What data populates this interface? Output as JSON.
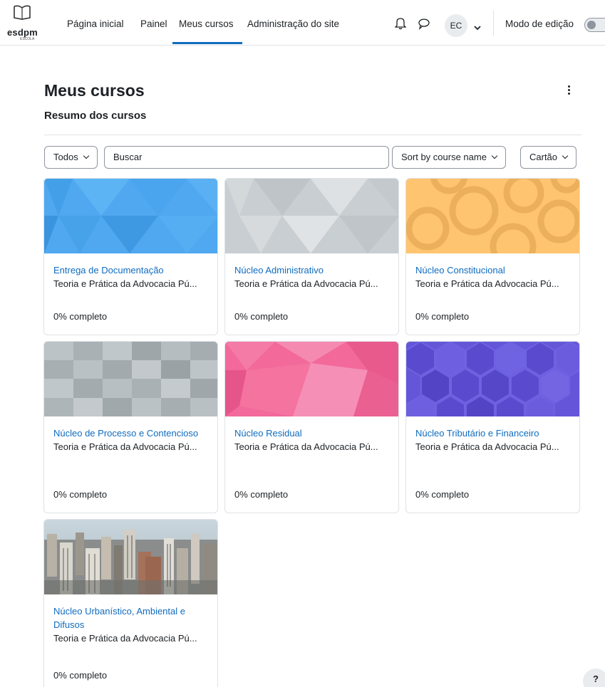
{
  "brand": {
    "name": "esdpm",
    "tagline": "ESCOLA"
  },
  "nav": {
    "items": [
      {
        "label": "Página inicial"
      },
      {
        "label": "Painel"
      },
      {
        "label": "Meus cursos"
      },
      {
        "label": "Administração do site"
      }
    ],
    "active": "Meus cursos",
    "user_initials": "EC",
    "edit_mode_label": "Modo de edição"
  },
  "header": {
    "title": "Meus cursos",
    "section": "Resumo dos cursos"
  },
  "filters": {
    "grouping": "Todos",
    "search_placeholder": "Buscar",
    "sort": "Sort by course name",
    "view": "Cartão"
  },
  "courses": [
    {
      "name": "Entrega de Documentação",
      "category": "Teoria e Prática da Advocacia Pú...",
      "progress": "0% completo",
      "pattern": "triangles",
      "color": "#4fa8f0"
    },
    {
      "name": "Núcleo Administrativo",
      "category": "Teoria e Prática da Advocacia Pú...",
      "progress": "0% completo",
      "pattern": "triangles",
      "color": "#c9ced2"
    },
    {
      "name": "Núcleo Constitucional",
      "category": "Teoria e Prática da Advocacia Pú...",
      "progress": "0% completo",
      "pattern": "circles",
      "color": "#ffc470"
    },
    {
      "name": "Núcleo de Processo e Contencioso",
      "category": "Teoria e Prática da Advocacia Pú...",
      "progress": "0% completo",
      "pattern": "squares",
      "color": "#b1b9bd"
    },
    {
      "name": "Núcleo Residual",
      "category": "Teoria e Prática da Advocacia Pú...",
      "progress": "0% completo",
      "pattern": "polygons",
      "color": "#f2699a"
    },
    {
      "name": "Núcleo Tributário e Financeiro",
      "category": "Teoria e Prática da Advocacia Pú...",
      "progress": "0% completo",
      "pattern": "hexagons",
      "color": "#6556d9"
    },
    {
      "name": "Núcleo Urbanístico, Ambiental e Difusos",
      "category": "Teoria e Prática da Advocacia Pú...",
      "progress": "0% completo",
      "pattern": "city-photo",
      "color": "#8b8f92"
    }
  ],
  "help_label": "?"
}
